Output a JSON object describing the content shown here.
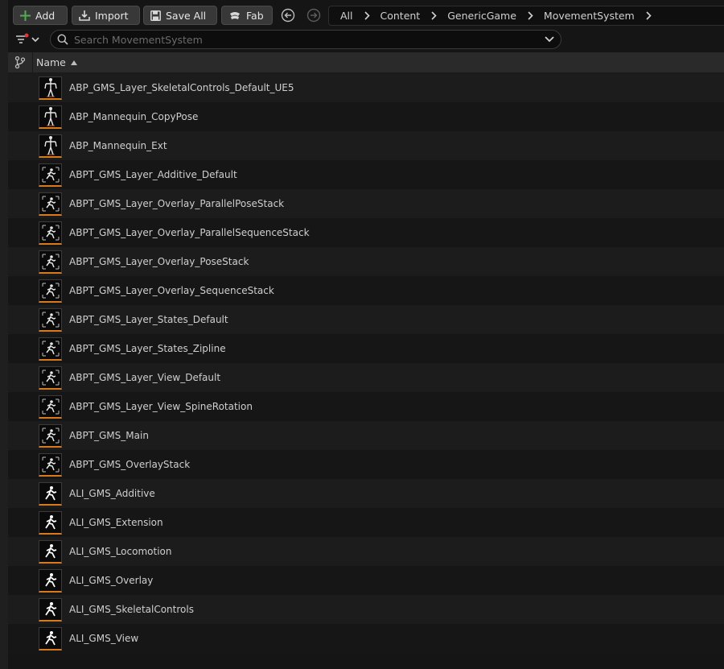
{
  "toolbar": {
    "add_label": "Add",
    "import_label": "Import",
    "save_all_label": "Save All",
    "fab_label": "Fab",
    "accent_add": "#4caf50"
  },
  "breadcrumb": [
    "All",
    "Content",
    "GenericGame",
    "MovementSystem"
  ],
  "search": {
    "placeholder": "Search MovementSystem",
    "value": ""
  },
  "columns": {
    "name_label": "Name",
    "sort": "ascending"
  },
  "thumbnail_accent": "#d97a1a",
  "assets": [
    {
      "name": "ABP_GMS_Layer_SkeletalControls_Default_UE5",
      "icon": "skeleton-mannequin-icon"
    },
    {
      "name": "ABP_Mannequin_CopyPose",
      "icon": "skeleton-mannequin-icon"
    },
    {
      "name": "ABP_Mannequin_Ext",
      "icon": "skeleton-mannequin-icon"
    },
    {
      "name": "ABPT_GMS_Layer_Additive_Default",
      "icon": "anim-template-icon"
    },
    {
      "name": "ABPT_GMS_Layer_Overlay_ParallelPoseStack",
      "icon": "anim-template-icon"
    },
    {
      "name": "ABPT_GMS_Layer_Overlay_ParallelSequenceStack",
      "icon": "anim-template-icon"
    },
    {
      "name": "ABPT_GMS_Layer_Overlay_PoseStack",
      "icon": "anim-template-icon"
    },
    {
      "name": "ABPT_GMS_Layer_Overlay_SequenceStack",
      "icon": "anim-template-icon"
    },
    {
      "name": "ABPT_GMS_Layer_States_Default",
      "icon": "anim-template-icon"
    },
    {
      "name": "ABPT_GMS_Layer_States_Zipline",
      "icon": "anim-template-icon"
    },
    {
      "name": "ABPT_GMS_Layer_View_Default",
      "icon": "anim-template-icon"
    },
    {
      "name": "ABPT_GMS_Layer_View_SpineRotation",
      "icon": "anim-template-icon"
    },
    {
      "name": "ABPT_GMS_Main",
      "icon": "anim-template-icon"
    },
    {
      "name": "ABPT_GMS_OverlayStack",
      "icon": "anim-template-icon"
    },
    {
      "name": "ALI_GMS_Additive",
      "icon": "anim-layer-interface-icon"
    },
    {
      "name": "ALI_GMS_Extension",
      "icon": "anim-layer-interface-icon"
    },
    {
      "name": "ALI_GMS_Locomotion",
      "icon": "anim-layer-interface-icon"
    },
    {
      "name": "ALI_GMS_Overlay",
      "icon": "anim-layer-interface-icon"
    },
    {
      "name": "ALI_GMS_SkeletalControls",
      "icon": "anim-layer-interface-icon"
    },
    {
      "name": "ALI_GMS_View",
      "icon": "anim-layer-interface-icon"
    }
  ]
}
